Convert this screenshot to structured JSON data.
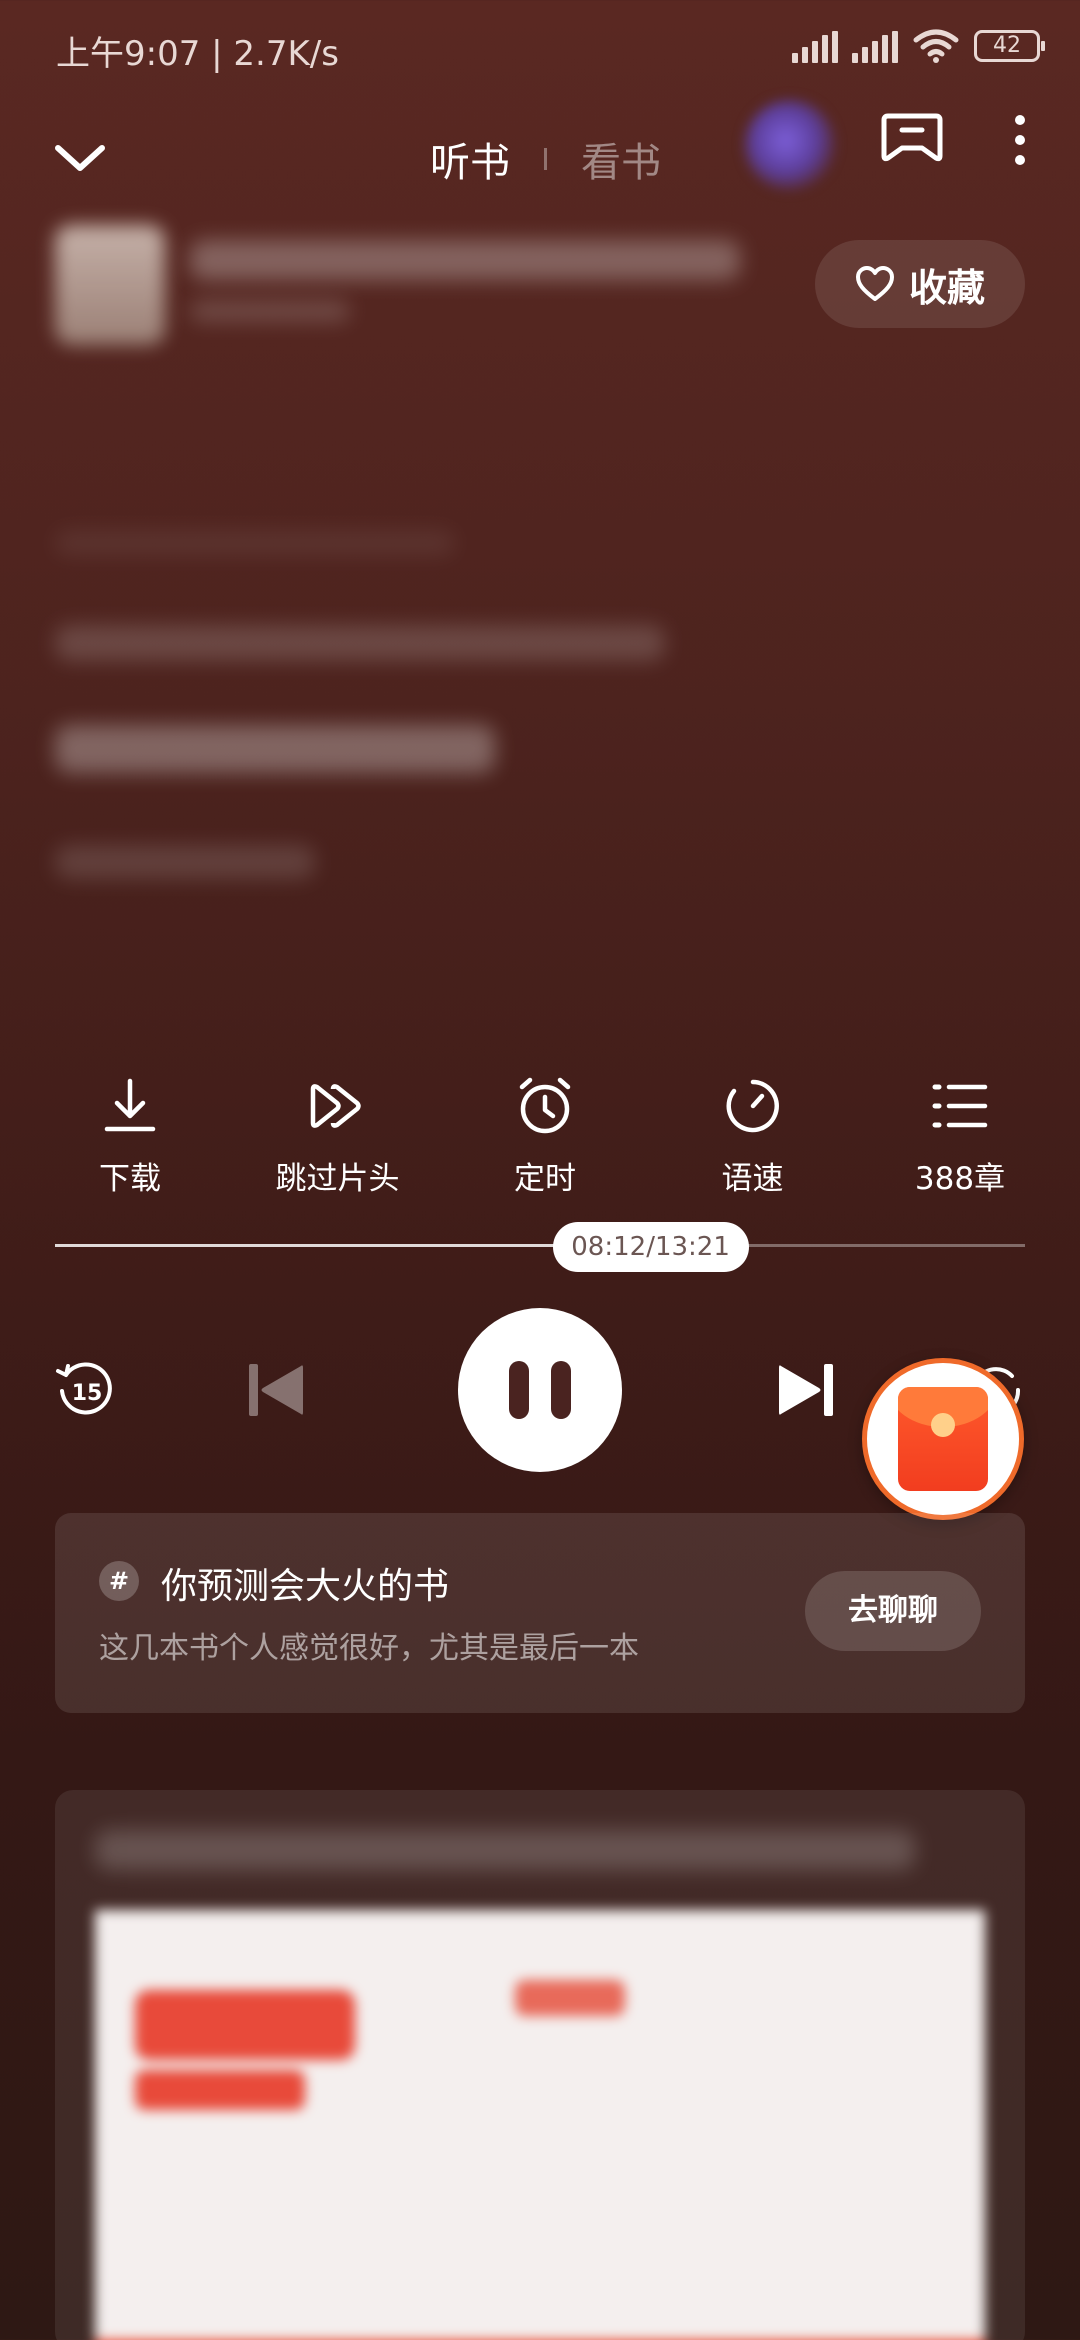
{
  "status_bar": {
    "time_and_speed": "上午9:07 | 2.7K/s",
    "battery": "42"
  },
  "header": {
    "tabs": [
      {
        "label": "听书",
        "active": true
      },
      {
        "label": "看书",
        "active": false
      }
    ]
  },
  "book": {
    "favorite_label": "收藏"
  },
  "actions": [
    {
      "label": "下载",
      "icon": "download-icon"
    },
    {
      "label": "跳过片头",
      "icon": "skip-intro-icon"
    },
    {
      "label": "定时",
      "icon": "timer-icon"
    },
    {
      "label": "语速",
      "icon": "speed-icon"
    },
    {
      "label": "388章",
      "icon": "chapter-list-icon"
    }
  ],
  "player": {
    "time_display": "08:12/13:21",
    "progress_fraction": 0.614,
    "rewind_label": "15"
  },
  "topic": {
    "hash": "#",
    "title": "你预测会大火的书",
    "subtitle": "这几本书个人感觉很好，尤其是最后一本",
    "button": "去聊聊"
  },
  "colors": {
    "background_top": "#5a2822",
    "background_bottom": "#2e1814",
    "redpacket": "#f23d1f",
    "redpacket_ring": "#ef6a2a"
  }
}
